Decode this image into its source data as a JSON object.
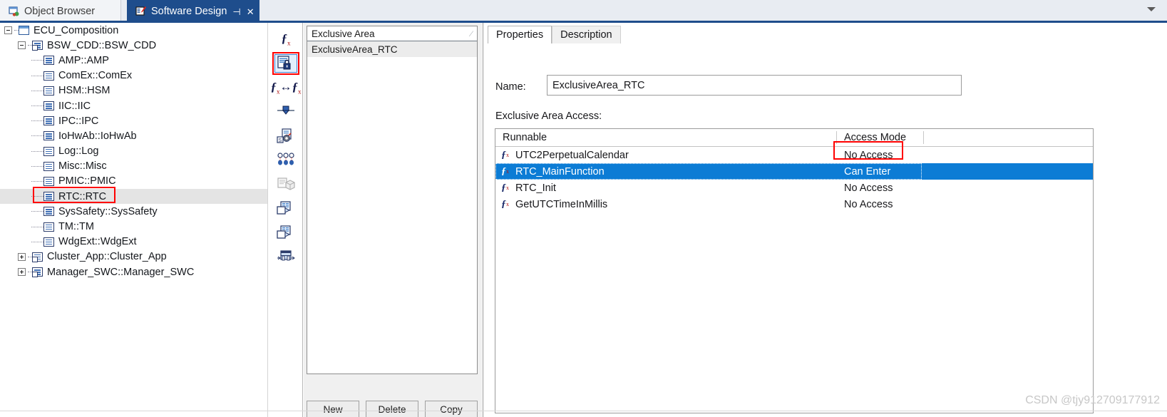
{
  "tabs": [
    {
      "label": "Object Browser",
      "icon": "object-browser-icon",
      "active": false
    },
    {
      "label": "Software Design",
      "icon": "software-design-icon",
      "active": true,
      "pin": "⊣",
      "close": "✕"
    }
  ],
  "tree": {
    "items": [
      {
        "label": "ECU_Composition",
        "depth": 0,
        "expander": "minus",
        "icon": "composition-icon",
        "selected": false
      },
      {
        "label": "BSW_CDD::BSW_CDD",
        "depth": 1,
        "expander": "minus",
        "icon": "component-icon",
        "selected": false
      },
      {
        "label": "AMP::AMP",
        "depth": 2,
        "expander": "none",
        "icon": "component-icon",
        "selected": false
      },
      {
        "label": "ComEx::ComEx",
        "depth": 2,
        "expander": "none",
        "icon": "component-icon",
        "selected": false
      },
      {
        "label": "HSM::HSM",
        "depth": 2,
        "expander": "none",
        "icon": "component-icon",
        "selected": false
      },
      {
        "label": "IIC::IIC",
        "depth": 2,
        "expander": "none",
        "icon": "component-icon",
        "selected": false
      },
      {
        "label": "IPC::IPC",
        "depth": 2,
        "expander": "none",
        "icon": "component-icon",
        "selected": false
      },
      {
        "label": "IoHwAb::IoHwAb",
        "depth": 2,
        "expander": "none",
        "icon": "component-icon",
        "selected": false
      },
      {
        "label": "Log::Log",
        "depth": 2,
        "expander": "none",
        "icon": "component-icon",
        "selected": false
      },
      {
        "label": "Misc::Misc",
        "depth": 2,
        "expander": "none",
        "icon": "component-icon",
        "selected": false
      },
      {
        "label": "PMIC::PMIC",
        "depth": 2,
        "expander": "none",
        "icon": "component-icon",
        "selected": false
      },
      {
        "label": "RTC::RTC",
        "depth": 2,
        "expander": "none",
        "icon": "component-icon",
        "selected": true
      },
      {
        "label": "SysSafety::SysSafety",
        "depth": 2,
        "expander": "none",
        "icon": "component-icon",
        "selected": false
      },
      {
        "label": "TM::TM",
        "depth": 2,
        "expander": "none",
        "icon": "component-icon",
        "selected": false
      },
      {
        "label": "WdgExt::WdgExt",
        "depth": 2,
        "expander": "none",
        "icon": "component-icon",
        "selected": false
      },
      {
        "label": "Cluster_App::Cluster_App",
        "depth": 1,
        "expander": "plus",
        "icon": "component-icon",
        "selected": false
      },
      {
        "label": "Manager_SWC::Manager_SWC",
        "depth": 1,
        "expander": "plus",
        "icon": "component-icon",
        "selected": false
      }
    ]
  },
  "toolbar": {
    "buttons": [
      {
        "name": "runnable-icon",
        "glyph": "fx"
      },
      {
        "name": "exclusive-area-icon",
        "glyph": "lock-doc",
        "selected": true
      },
      {
        "name": "runnable-mapping-icon",
        "glyph": "fx-fx"
      },
      {
        "name": "port-icon",
        "glyph": "port"
      },
      {
        "name": "service-needs-icon",
        "glyph": "service"
      },
      {
        "name": "data-elements-icon",
        "glyph": "dots"
      },
      {
        "name": "package-icon",
        "glyph": "package"
      },
      {
        "name": "copy-doc-icon",
        "glyph": "copy-doc"
      },
      {
        "name": "paste-doc-icon",
        "glyph": "paste-doc"
      },
      {
        "name": "connector-icon",
        "glyph": "connector"
      }
    ]
  },
  "exclusive_area_list": {
    "header": "Exclusive Area",
    "sort_indicator": "⁄",
    "items": [
      {
        "label": "ExclusiveArea_RTC",
        "selected": true
      }
    ],
    "buttons": [
      {
        "label": "New"
      },
      {
        "label": "Delete"
      },
      {
        "label": "Copy"
      }
    ]
  },
  "properties": {
    "tabs": [
      {
        "label": "Properties",
        "active": true
      },
      {
        "label": "Description",
        "active": false
      }
    ],
    "name_label": "Name:",
    "name_value": "ExclusiveArea_RTC",
    "access_label": "Exclusive Area Access:",
    "grid": {
      "columns": [
        "Runnable",
        "Access Mode"
      ],
      "rows": [
        {
          "runnable": "UTC2PerpetualCalendar",
          "access_mode": "No Access",
          "selected": false
        },
        {
          "runnable": "RTC_MainFunction",
          "access_mode": "Can Enter",
          "selected": true
        },
        {
          "runnable": "RTC_Init",
          "access_mode": "No Access",
          "selected": false
        },
        {
          "runnable": "GetUTCTimeInMillis",
          "access_mode": "No Access",
          "selected": false
        }
      ]
    }
  },
  "watermark": "CSDN @tjy912709177912",
  "colors": {
    "tab_active_bg": "#1e4d8c",
    "selection_blue": "#0c7cd5",
    "annotation_red": "#ff0000",
    "tree_selected_bg": "#e4e4e4"
  }
}
